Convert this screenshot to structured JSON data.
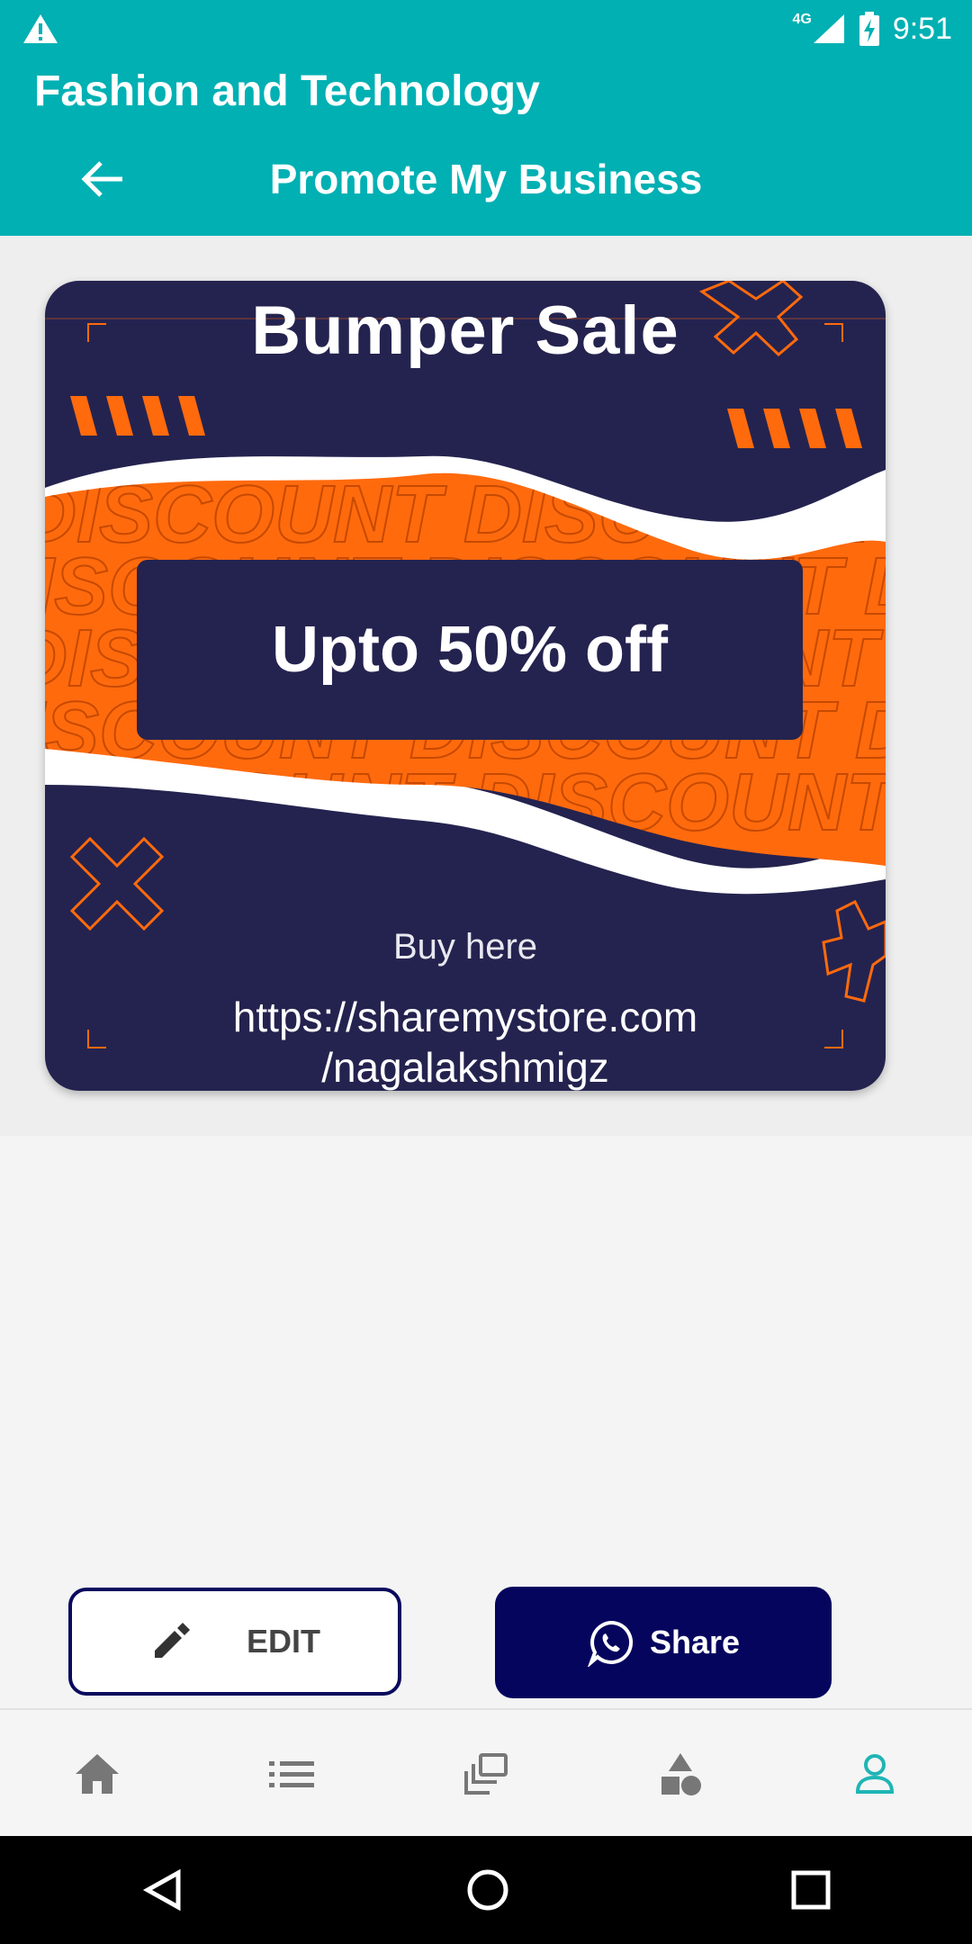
{
  "status_bar": {
    "time": "9:51",
    "network": "4G"
  },
  "app_bar": {
    "app_title": "Fashion and Technology",
    "page_title": "Promote My Business"
  },
  "poster": {
    "heading": "Bumper Sale",
    "offer": "Upto 50% off",
    "pattern_text": "DISCOUNT DISCOUNT DISCOUNT",
    "cta": "Buy here",
    "url_line1": "https://sharemystore.com",
    "url_line2": "/nagalakshmigz"
  },
  "actions": {
    "edit_label": "EDIT",
    "share_label": "Share"
  },
  "bottom_nav": {
    "items": [
      {
        "icon": "home-icon",
        "active": false
      },
      {
        "icon": "list-icon",
        "active": false
      },
      {
        "icon": "collections-icon",
        "active": false
      },
      {
        "icon": "categories-icon",
        "active": false
      },
      {
        "icon": "profile-icon",
        "active": true
      }
    ]
  },
  "colors": {
    "accent": "#00b0b3",
    "poster_navy": "#24234f",
    "poster_orange": "#ff6a0d",
    "share_button": "#05055e",
    "nav_inactive": "#777777",
    "nav_active": "#1fb5b5"
  }
}
